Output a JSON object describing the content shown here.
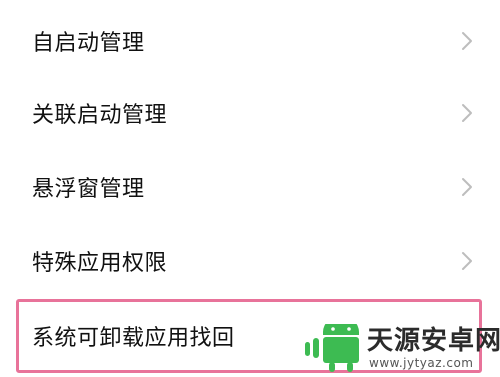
{
  "settings": {
    "items": [
      {
        "label": "自启动管理",
        "icon": "chevron-right-icon"
      },
      {
        "label": "关联启动管理",
        "icon": "chevron-right-icon"
      },
      {
        "label": "悬浮窗管理",
        "icon": "chevron-right-icon"
      },
      {
        "label": "特殊应用权限",
        "icon": "chevron-right-icon"
      },
      {
        "label": "系统可卸载应用找回"
      }
    ]
  },
  "highlight": {
    "color": "#e8739a"
  },
  "watermark": {
    "title": "天源安卓网",
    "url": "www.jytyaz.com",
    "logo_color": "#3dbb52"
  }
}
